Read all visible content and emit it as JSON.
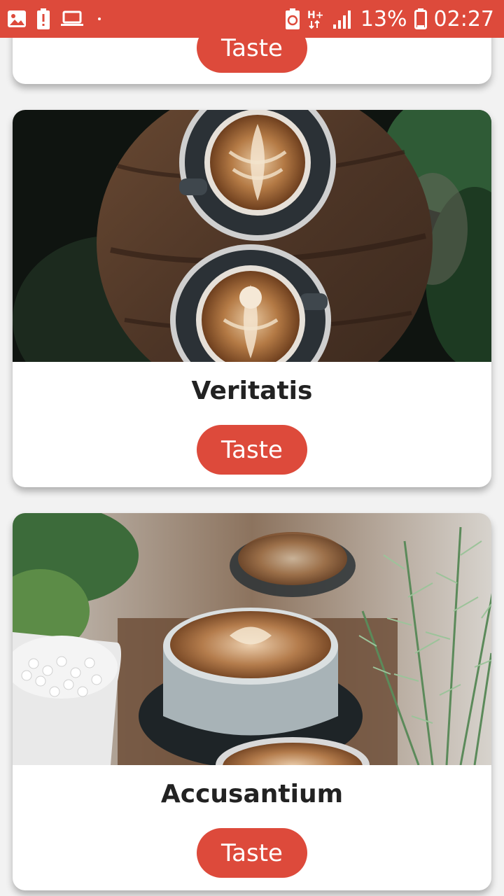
{
  "status_bar": {
    "battery_percent": "13%",
    "time": "02:27",
    "network": "H+",
    "icons_left": [
      "gallery-icon",
      "battery-alert-icon",
      "laptop-icon",
      "dot-icon"
    ],
    "icons_right": [
      "battery-saver-icon",
      "network-type-icon",
      "signal-icon",
      "battery-icon"
    ],
    "color": "#dd4a3b"
  },
  "cards": [
    {
      "title": "",
      "button_label": "Taste"
    },
    {
      "title": "Veritatis",
      "button_label": "Taste",
      "image": "coffee-cups-on-wooden-table"
    },
    {
      "title": "Accusantium",
      "button_label": "Taste",
      "image": "coffee-cups-with-plants"
    }
  ],
  "accent_color": "#dd4a3b"
}
